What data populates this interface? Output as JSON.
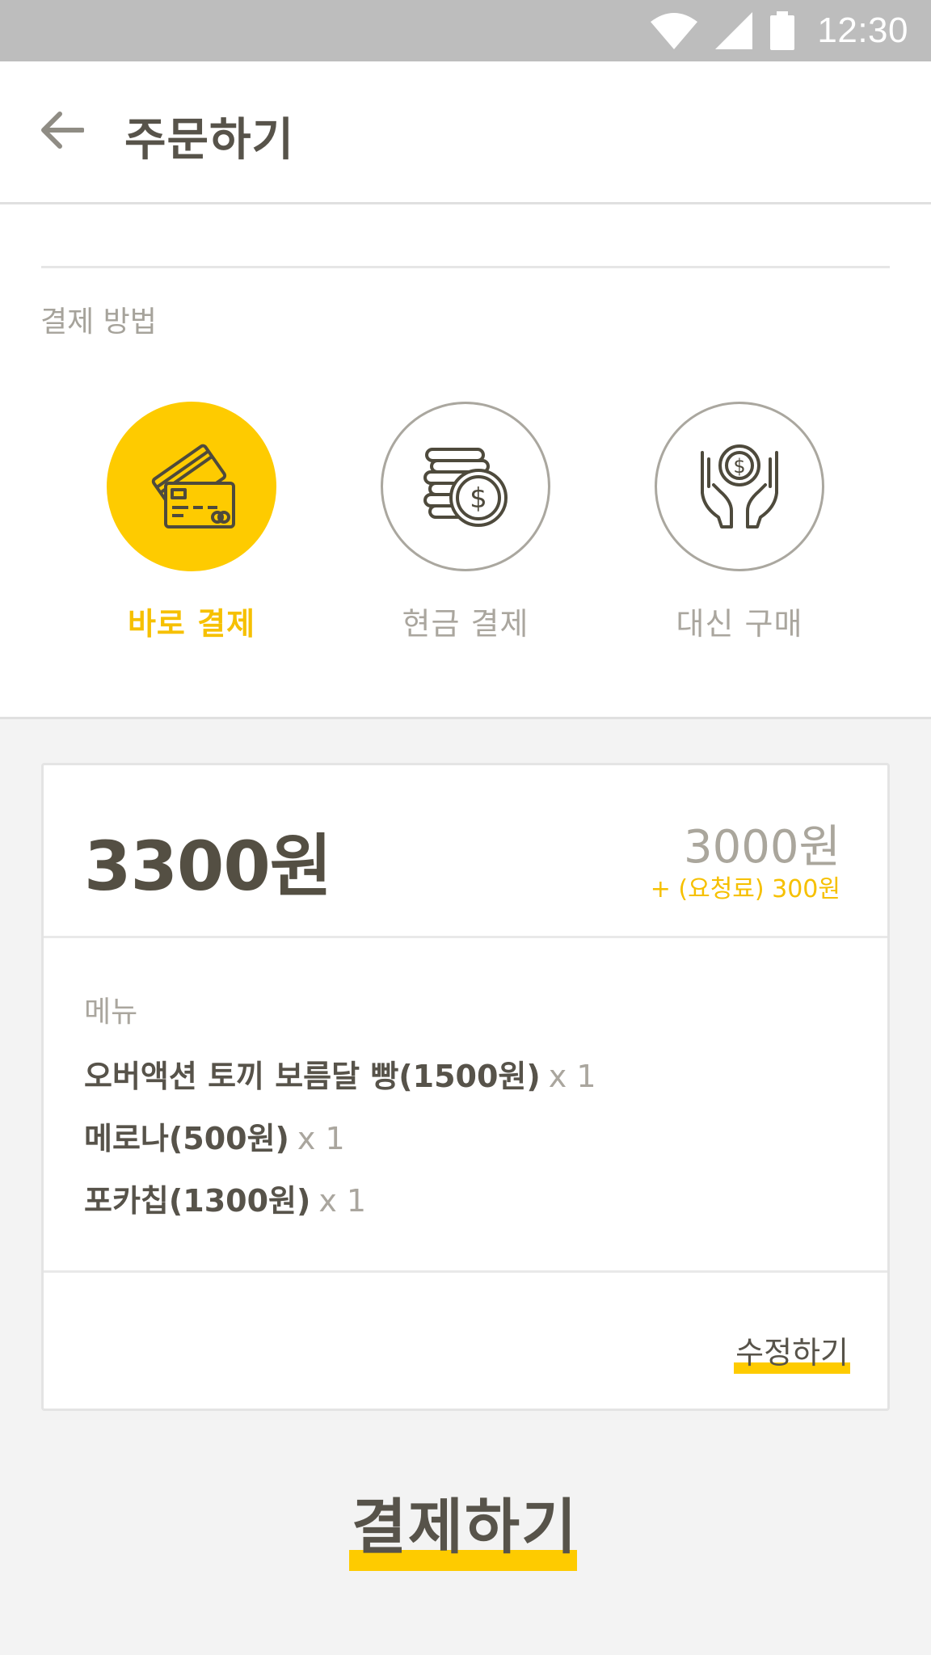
{
  "status_bar": {
    "time": "12:30",
    "icons": [
      "wifi-icon",
      "cellular-signal-icon",
      "battery-icon"
    ]
  },
  "header": {
    "back_icon": "arrow-left-icon",
    "title": "주문하기"
  },
  "payment": {
    "section_label": "결제 방법",
    "methods": [
      {
        "label": "바로 결제",
        "icon": "credit-card-icon",
        "selected": true
      },
      {
        "label": "현금 결제",
        "icon": "coins-icon",
        "selected": false
      },
      {
        "label": "대신 구매",
        "icon": "hands-coin-icon",
        "selected": false
      }
    ]
  },
  "order": {
    "total": "3300원",
    "subtotal": "3000원",
    "fee": "+ (요청료) 300원",
    "menu_label": "메뉴",
    "items": [
      {
        "name": "오버액션 토끼 보름달 빵(1500원)",
        "qty": "x 1"
      },
      {
        "name": "메로나(500원)",
        "qty": "x 1"
      },
      {
        "name": "포카칩(1300원)",
        "qty": "x 1"
      }
    ],
    "edit_label": "수정하기"
  },
  "pay_button_label": "결제하기",
  "colors": {
    "accent": "#fecb00",
    "text_dark": "#57534a",
    "text_muted": "#aaa69e",
    "status_bar": "#bdbdbd"
  }
}
